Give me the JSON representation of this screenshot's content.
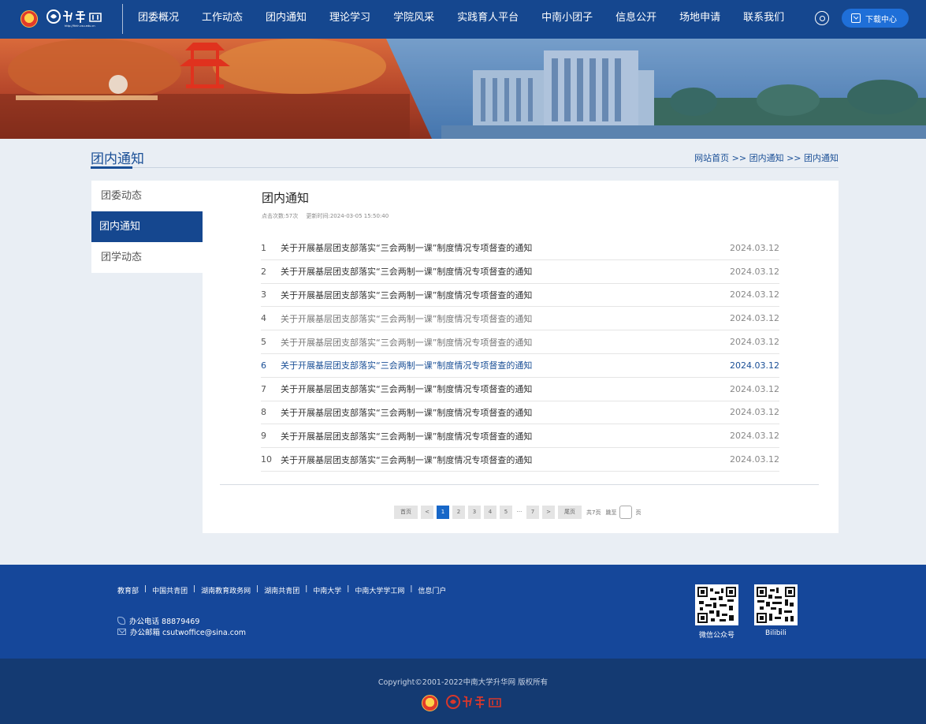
{
  "header": {
    "site_url_text": "http://fhhh.csu.edu.cn",
    "nav": [
      "团委概况",
      "工作动态",
      "团内通知",
      "理论学习",
      "学院风采",
      "实践育人平台",
      "中南小团子",
      "信息公开",
      "场地申请",
      "联系我们"
    ],
    "download_label": "下载中心"
  },
  "section": {
    "title": "团内通知",
    "breadcrumb": "网站首页 >> 团内通知 >> 团内通知"
  },
  "sidebar": {
    "items": [
      {
        "label": "团委动态",
        "active": false
      },
      {
        "label": "团内通知",
        "active": true
      },
      {
        "label": "团学动态",
        "active": false
      }
    ]
  },
  "content": {
    "title": "团内通知",
    "views": "点击次数:57次",
    "updated": "更新时间:2024-03-05 15:50:40",
    "list": [
      {
        "num": "1",
        "title": "关于开展基层团支部落实“三会两制一课”制度情况专项督查的通知",
        "date": "2024.03.12",
        "state": "normal"
      },
      {
        "num": "2",
        "title": "关于开展基层团支部落实“三会两制一课”制度情况专项督查的通知",
        "date": "2024.03.12",
        "state": "normal"
      },
      {
        "num": "3",
        "title": "关于开展基层团支部落实“三会两制一课”制度情况专项督查的通知",
        "date": "2024.03.12",
        "state": "normal"
      },
      {
        "num": "4",
        "title": "关于开展基层团支部落实“三会两制一课”制度情况专项督查的通知",
        "date": "2024.03.12",
        "state": "dim"
      },
      {
        "num": "5",
        "title": "关于开展基层团支部落实“三会两制一课”制度情况专项督查的通知",
        "date": "2024.03.12",
        "state": "dim"
      },
      {
        "num": "6",
        "title": "关于开展基层团支部落实“三会两制一课”制度情况专项督查的通知",
        "date": "2024.03.12",
        "state": "highlight"
      },
      {
        "num": "7",
        "title": "关于开展基层团支部落实“三会两制一课”制度情况专项督查的通知",
        "date": "2024.03.12",
        "state": "normal"
      },
      {
        "num": "8",
        "title": "关于开展基层团支部落实“三会两制一课”制度情况专项督查的通知",
        "date": "2024.03.12",
        "state": "normal"
      },
      {
        "num": "9",
        "title": "关于开展基层团支部落实“三会两制一课”制度情况专项督查的通知",
        "date": "2024.03.12",
        "state": "normal"
      },
      {
        "num": "10",
        "title": "关于开展基层团支部落实“三会两制一课”制度情况专项督查的通知",
        "date": "2024.03.12",
        "state": "normal"
      }
    ]
  },
  "pagination": {
    "first": "首页",
    "prev": "<",
    "pages": [
      "1",
      "2",
      "3",
      "4",
      "5"
    ],
    "current": "1",
    "ellipsis": "···",
    "last_page": "7",
    "next": ">",
    "last": "尾页",
    "total": "共7页",
    "jump_prefix": "跳至",
    "jump_suffix": "页"
  },
  "footer": {
    "links": [
      "教育部",
      "中国共青团",
      "湖南教育政务网",
      "湖南共青团",
      "中南大学",
      "中南大学学工网",
      "信息门户"
    ],
    "link_separator": "|",
    "phone": "办公电话 88879469",
    "email": "办公邮箱 csutwoffice@sina.com",
    "qr_codes": [
      {
        "label": "微信公众号"
      },
      {
        "label": "Bilibili"
      }
    ],
    "copyright": "Copyright©2001-2022中南大学升华网 版权所有"
  },
  "colors": {
    "header_bg": "#15478f",
    "accent": "#1767c8",
    "footer_top": "#15479a",
    "footer_bottom": "#143a72",
    "highlight_text": "#1a4f96"
  }
}
